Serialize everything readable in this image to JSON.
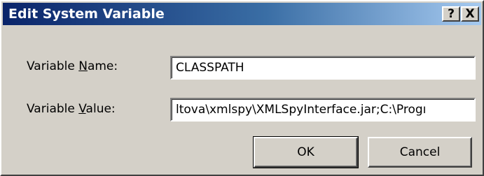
{
  "window": {
    "title": "Edit System Variable",
    "help_glyph": "?",
    "close_glyph": "X"
  },
  "form": {
    "name_label_pre": "Variable ",
    "name_label_key": "N",
    "name_label_post": "ame:",
    "name_value": "CLASSPATH",
    "value_label_pre": "Variable ",
    "value_label_key": "V",
    "value_label_post": "alue:",
    "value_value": "ltova\\xmlspy\\XMLSpyInterface.jar;C:\\Progı"
  },
  "buttons": {
    "ok_label": "OK",
    "cancel_label": "Cancel"
  },
  "colors": {
    "title_gradient_start": "#0a246a",
    "title_gradient_end": "#a6caf0",
    "face": "#d4d0c8"
  }
}
